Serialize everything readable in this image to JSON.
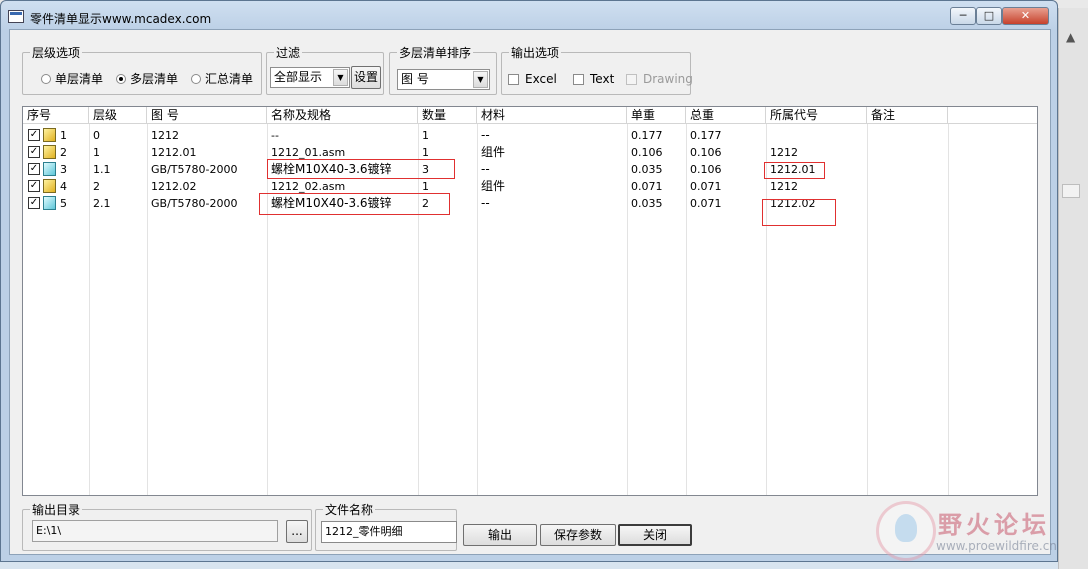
{
  "window": {
    "title": "零件清单显示www.mcadex.com",
    "min_label": "─",
    "max_label": "□",
    "close_label": "✕"
  },
  "level_options": {
    "legend": "层级选项",
    "single": "单层清单",
    "multi": "多层清单",
    "summary": "汇总清单",
    "selected": "multi"
  },
  "filter": {
    "legend": "过滤",
    "value": "全部显示",
    "setup_button": "设置"
  },
  "sort": {
    "legend": "多层清单排序",
    "value": "图 号"
  },
  "output_options": {
    "legend": "输出选项",
    "excel": "Excel",
    "text": "Text",
    "drawing": "Drawing"
  },
  "table": {
    "columns": [
      "序号",
      "层级",
      "图 号",
      "名称及规格",
      "数量",
      "材料",
      "单重",
      "总重",
      "所属代号",
      "备注"
    ],
    "rows": [
      {
        "seq": "1",
        "level": "0",
        "drawing_no": "1212",
        "name": "--",
        "qty": "1",
        "material": "--",
        "unit_weight": "0.177",
        "total_weight": "0.177",
        "parent": "",
        "remark": "",
        "icon": "assembly-icon"
      },
      {
        "seq": "2",
        "level": "1",
        "drawing_no": "1212.01",
        "name": "1212_01.asm",
        "qty": "1",
        "material": "组件",
        "unit_weight": "0.106",
        "total_weight": "0.106",
        "parent": "1212",
        "remark": "",
        "icon": "assembly-icon"
      },
      {
        "seq": "3",
        "level": "1.1",
        "drawing_no": "GB/T5780-2000",
        "name": "螺栓M10X40-3.6镀锌",
        "qty": "3",
        "material": "--",
        "unit_weight": "0.035",
        "total_weight": "0.106",
        "parent": "1212.01",
        "remark": "",
        "icon": "part-icon"
      },
      {
        "seq": "4",
        "level": "2",
        "drawing_no": "1212.02",
        "name": "1212_02.asm",
        "qty": "1",
        "material": "组件",
        "unit_weight": "0.071",
        "total_weight": "0.071",
        "parent": "1212",
        "remark": "",
        "icon": "assembly-icon"
      },
      {
        "seq": "5",
        "level": "2.1",
        "drawing_no": "GB/T5780-2000",
        "name": "螺栓M10X40-3.6镀锌",
        "qty": "2",
        "material": "--",
        "unit_weight": "0.035",
        "total_weight": "0.071",
        "parent": "1212.02",
        "remark": "",
        "icon": "part-icon"
      }
    ]
  },
  "output_dir": {
    "legend": "输出目录",
    "value": "E:\\1\\",
    "browse_button": "..."
  },
  "file_name": {
    "legend": "文件名称",
    "value": "1212_零件明细"
  },
  "buttons": {
    "export": "输出",
    "save_params": "保存参数",
    "close": "关闭"
  },
  "watermark": {
    "title": "野火论坛",
    "url": "www.proewildfire.cn"
  }
}
